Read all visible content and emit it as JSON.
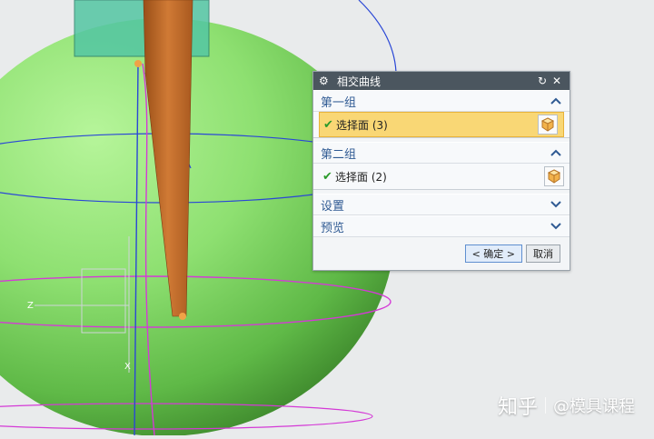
{
  "dialog": {
    "title": "相交曲线",
    "group1": {
      "header": "第一组",
      "row_label": "选择面 (3)"
    },
    "group2": {
      "header": "第二组",
      "row_label": "选择面 (2)"
    },
    "settings_header": "设置",
    "preview_header": "预览",
    "ok_label": "< 确定 >",
    "cancel_label": "取消"
  },
  "watermark": {
    "brand": "知乎",
    "author": "@模具课程"
  },
  "axis_labels": {
    "z": "Z",
    "x": "X"
  },
  "icons": {
    "title": "gear-icon",
    "reset": "refresh-icon",
    "close": "close-icon",
    "collapse": "chevron-up-icon",
    "expand": "chevron-down-icon",
    "face_selector": "cube-face-icon",
    "check": "check-icon"
  },
  "colors": {
    "sphere": "#6fcf5c",
    "surface": "#c06a2a",
    "curve_blue": "#2a47d6",
    "curve_magenta": "#d43ad6",
    "active_row": "#f9d775",
    "title_bar": "#4b565f"
  }
}
